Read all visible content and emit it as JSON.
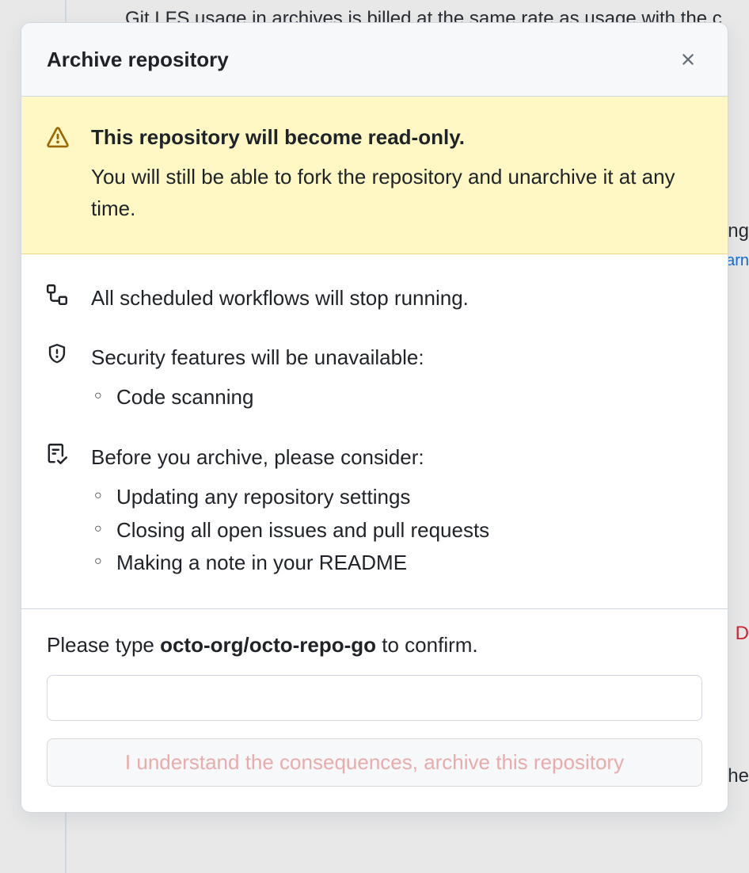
{
  "background": {
    "lfs_text": "Git LFS usage in archives is billed at the same rate as usage with the c",
    "fragment_ng": "ng",
    "fragment_arn": "arn",
    "fragment_d": "D",
    "fragment_he": "he"
  },
  "modal": {
    "title": "Archive repository",
    "warning": {
      "title": "This repository will become read-only.",
      "description": "You will still be able to fork the repository and unarchive it at any time."
    },
    "workflows_text": "All scheduled workflows will stop running.",
    "security": {
      "heading": "Security features will be unavailable:",
      "items": [
        "Code scanning"
      ]
    },
    "consider": {
      "heading": "Before you archive, please consider:",
      "items": [
        "Updating any repository settings",
        "Closing all open issues and pull requests",
        "Making a note in your README"
      ]
    },
    "confirm": {
      "prompt_prefix": "Please type ",
      "repo_name": "octo-org/octo-repo-go",
      "prompt_suffix": " to confirm.",
      "input_value": "",
      "button_label": "I understand the consequences, archive this repository"
    }
  }
}
